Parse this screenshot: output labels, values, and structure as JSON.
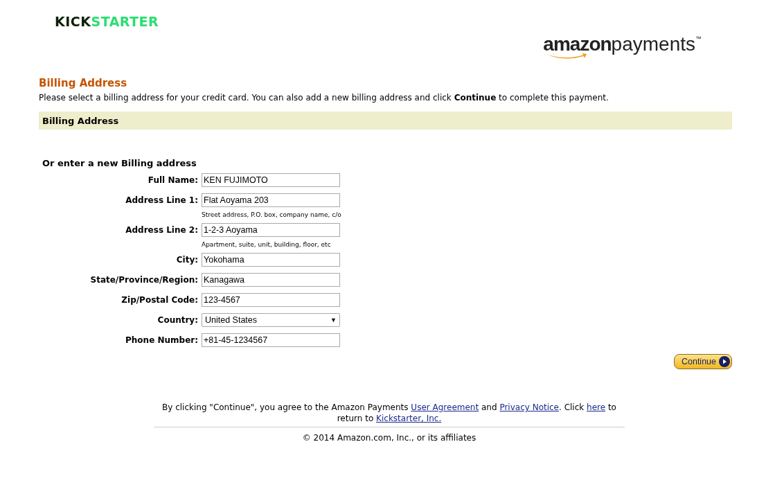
{
  "header": {
    "site_logo": [
      {
        "text": "KICK",
        "color": "#0f2105"
      },
      {
        "text": "STARTER",
        "color": "#2bde73"
      }
    ],
    "payments_logo": {
      "brand": "amazon",
      "product": "payments",
      "mark": "™"
    }
  },
  "page": {
    "title": "Billing Address",
    "intro": "Please select a billing address for your credit card. You can also add a new billing address and click **Continue** to complete this payment."
  },
  "section_bar": {
    "title": "Billing Address"
  },
  "form": {
    "title": "Or enter a new Billing address",
    "fields": [
      {
        "kind": "text",
        "label": "Full Name:",
        "value": "KEN FUJIMOTO"
      },
      {
        "kind": "text",
        "label": "Address Line 1:",
        "value": "Flat Aoyama 203",
        "hint": "Street address, P.O. box, company name, c/o"
      },
      {
        "kind": "text",
        "label": "Address Line 2:",
        "value": "1-2-3 Aoyama",
        "hint": "Apartment, suite, unit, building, floor, etc"
      },
      {
        "kind": "text",
        "label": "City:",
        "value": "Yokohama"
      },
      {
        "kind": "text",
        "label": "State/Province/Region:",
        "value": "Kanagawa"
      },
      {
        "kind": "text",
        "label": "Zip/Postal Code:",
        "value": "123-4567"
      },
      {
        "kind": "select",
        "label": "Country:",
        "value": "United States",
        "caret": "▼"
      },
      {
        "kind": "text",
        "label": "Phone Number:",
        "value": "+81-45-1234567"
      }
    ],
    "continue_button": "Continue"
  },
  "footer": {
    "agreement": [
      {
        "kind": "text",
        "text": "By clicking \"Continue\", you agree to the Amazon Payments "
      },
      {
        "kind": "link",
        "text": "User Agreement"
      },
      {
        "kind": "text",
        "text": " and "
      },
      {
        "kind": "link",
        "text": "Privacy Notice"
      },
      {
        "kind": "text",
        "text": ". Click "
      },
      {
        "kind": "link",
        "text": "here"
      },
      {
        "kind": "text",
        "text": " to return to "
      },
      {
        "kind": "link",
        "text": "Kickstarter, Inc."
      }
    ],
    "copyright": "© 2014 Amazon.com, Inc., or its affiliates"
  }
}
